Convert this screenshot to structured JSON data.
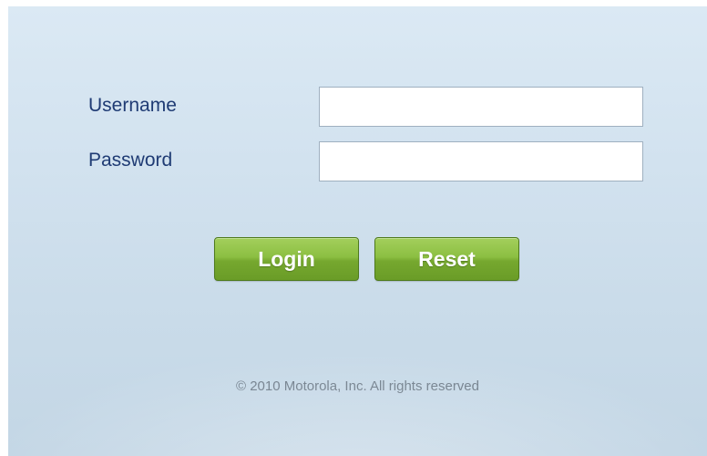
{
  "form": {
    "username": {
      "label": "Username",
      "value": "",
      "placeholder": ""
    },
    "password": {
      "label": "Password",
      "value": "",
      "placeholder": ""
    }
  },
  "buttons": {
    "login_label": "Login",
    "reset_label": "Reset"
  },
  "footer": {
    "copyright": "© 2010 Motorola, Inc. All rights reserved"
  },
  "colors": {
    "label_text": "#1f3b74",
    "button_green": "#8cbf42",
    "background": "#d2e2ef",
    "footer_text": "#6e7c89"
  }
}
